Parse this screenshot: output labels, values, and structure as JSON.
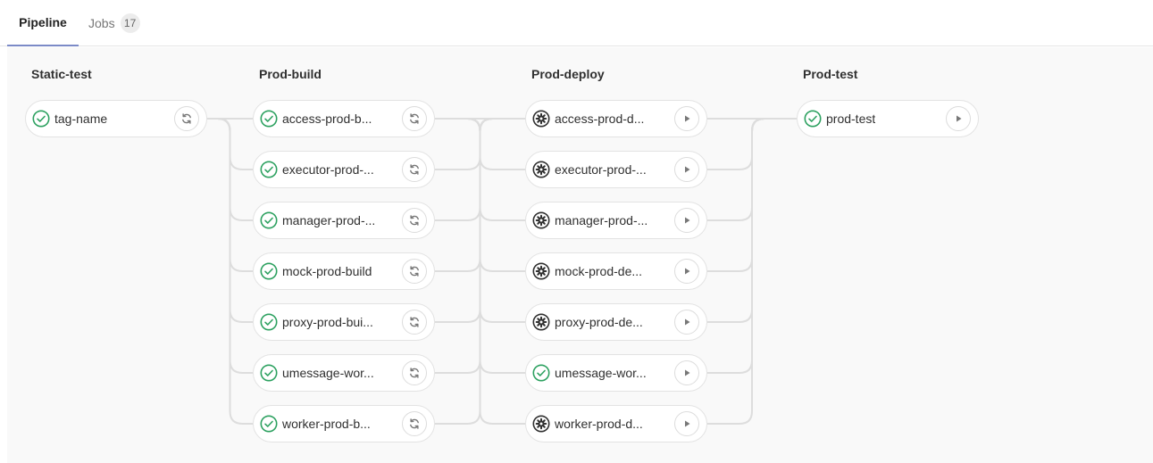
{
  "tabs": [
    {
      "label": "Pipeline",
      "active": true
    },
    {
      "label": "Jobs",
      "count": "17",
      "active": false
    }
  ],
  "colors": {
    "success": "#2da160",
    "manual": "#303030",
    "connector": "#dddddd"
  },
  "stages": [
    {
      "title": "Static-test",
      "action_icon": "retry-icon",
      "jobs": [
        {
          "name": "tag-name",
          "status": "success"
        }
      ]
    },
    {
      "title": "Prod-build",
      "action_icon": "retry-icon",
      "jobs": [
        {
          "name": "access-prod-b...",
          "status": "success"
        },
        {
          "name": "executor-prod-...",
          "status": "success"
        },
        {
          "name": "manager-prod-...",
          "status": "success"
        },
        {
          "name": "mock-prod-build",
          "status": "success"
        },
        {
          "name": "proxy-prod-bui...",
          "status": "success"
        },
        {
          "name": "umessage-wor...",
          "status": "success"
        },
        {
          "name": "worker-prod-b...",
          "status": "success"
        }
      ]
    },
    {
      "title": "Prod-deploy",
      "action_icon": "play-icon",
      "jobs": [
        {
          "name": "access-prod-d...",
          "status": "manual"
        },
        {
          "name": "executor-prod-...",
          "status": "manual"
        },
        {
          "name": "manager-prod-...",
          "status": "manual"
        },
        {
          "name": "mock-prod-de...",
          "status": "manual"
        },
        {
          "name": "proxy-prod-de...",
          "status": "manual"
        },
        {
          "name": "umessage-wor...",
          "status": "success"
        },
        {
          "name": "worker-prod-d...",
          "status": "manual"
        }
      ]
    },
    {
      "title": "Prod-test",
      "action_icon": "play-icon",
      "jobs": [
        {
          "name": "prod-test",
          "status": "success"
        }
      ]
    }
  ]
}
